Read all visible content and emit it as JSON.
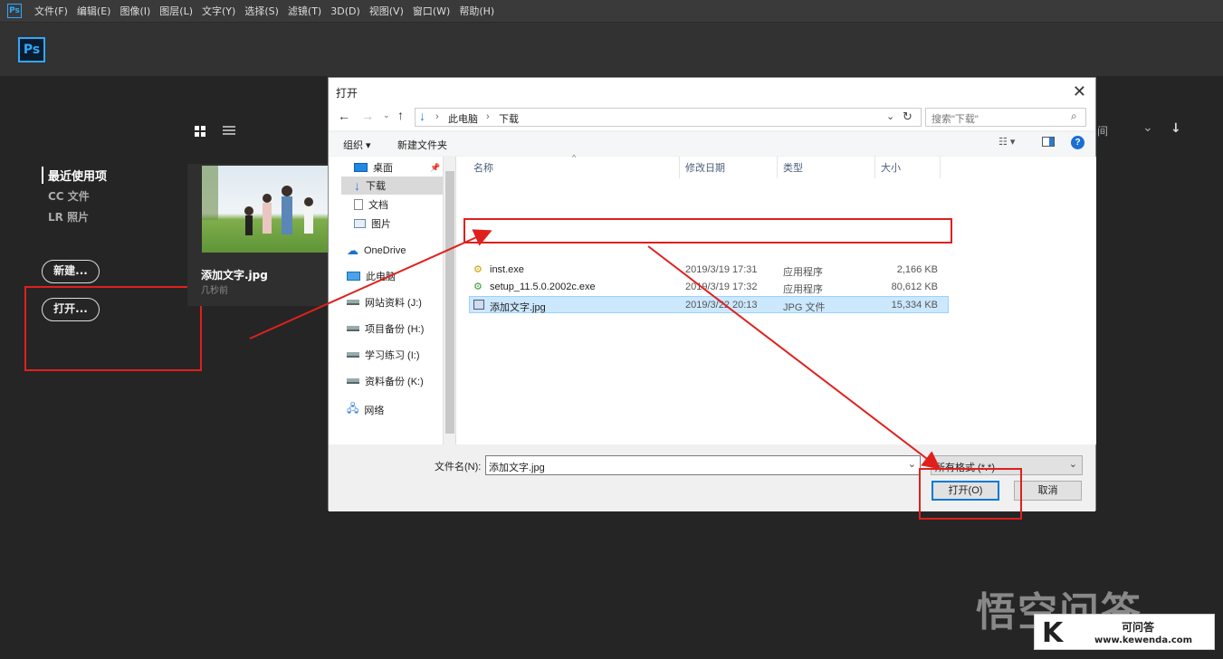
{
  "app": {
    "mini_logo": "Ps",
    "logo": "Ps"
  },
  "menubar": {
    "items": [
      "文件(F)",
      "编辑(E)",
      "图像(I)",
      "图层(L)",
      "文字(Y)",
      "选择(S)",
      "滤镜(T)",
      "3D(D)",
      "视图(V)",
      "窗口(W)",
      "帮助(H)"
    ]
  },
  "home": {
    "nav_title": "最近使用项",
    "nav_items": [
      "CC 文件",
      "LR 照片"
    ],
    "new_button": "新建...",
    "open_button": "打开...",
    "recent_file_name": "添加文字.jpg",
    "recent_file_time": "几秒前",
    "sort_label": "间"
  },
  "dialog": {
    "title": "打开",
    "breadcrumb": [
      "此电脑",
      "下载"
    ],
    "search_placeholder": "搜索\"下载\"",
    "organize": "组织 ▾",
    "new_folder": "新建文件夹",
    "nav_items": [
      {
        "label": "桌面",
        "icon": "desktop-icon"
      },
      {
        "label": "下载",
        "icon": "download-icon"
      },
      {
        "label": "文档",
        "icon": "document-icon"
      },
      {
        "label": "图片",
        "icon": "picture-icon"
      },
      {
        "label": "OneDrive",
        "icon": "cloud-icon"
      },
      {
        "label": "此电脑",
        "icon": "computer-icon"
      },
      {
        "label": "网站资料 (J:)",
        "icon": "drive-icon"
      },
      {
        "label": "项目备份 (H:)",
        "icon": "drive-icon"
      },
      {
        "label": "学习练习 (I:)",
        "icon": "drive-icon"
      },
      {
        "label": "资料备份 (K:)",
        "icon": "drive-icon"
      },
      {
        "label": "网络",
        "icon": "network-icon"
      }
    ],
    "columns": [
      "名称",
      "修改日期",
      "类型",
      "大小"
    ],
    "files": [
      {
        "name": "inst.exe",
        "date": "2019/3/19 17:31",
        "type": "应用程序",
        "size": "2,166 KB"
      },
      {
        "name": "setup_11.5.0.2002c.exe",
        "date": "2019/3/19 17:32",
        "type": "应用程序",
        "size": "80,612 KB"
      },
      {
        "name": "添加文字.jpg",
        "date": "2019/3/22 20:13",
        "type": "JPG 文件",
        "size": "15,334 KB"
      }
    ],
    "filename_label": "文件名(N):",
    "filename_value": "添加文字.jpg",
    "filter_value": "所有格式 (*.*)",
    "open_button": "打开(O)",
    "cancel_button": "取消"
  },
  "watermark": {
    "text": "悟空问答",
    "badge_letter": "K",
    "badge_title": "可问答",
    "badge_url": "www.kewenda.com"
  },
  "colors": {
    "annotation_red": "#e0201d",
    "ps_blue": "#31a8ff",
    "selection": "#cce8ff"
  }
}
